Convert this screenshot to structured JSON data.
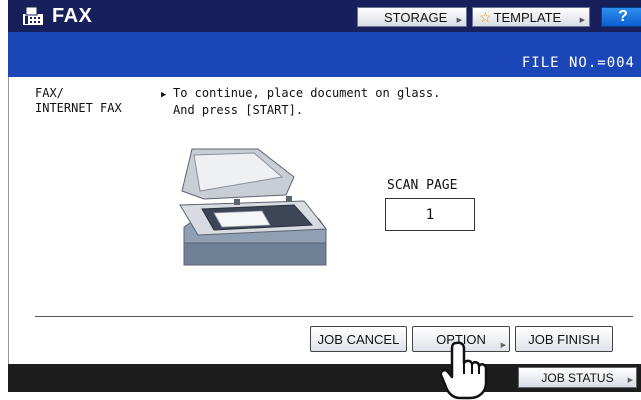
{
  "app": {
    "title": "FAX"
  },
  "toolbar": {
    "storage_label": "STORAGE",
    "template_label": "TEMPLATE",
    "help_label": "?"
  },
  "header": {
    "file_no": "FILE NO.=004"
  },
  "mode": {
    "line1": "FAX/",
    "line2": "INTERNET FAX"
  },
  "message": {
    "line1": "To continue, place document on glass.",
    "line2": "And press [START]."
  },
  "scan": {
    "label": "SCAN PAGE",
    "value": "1"
  },
  "actions": {
    "job_cancel": "JOB CANCEL",
    "option": "OPTION",
    "job_finish": "JOB FINISH"
  },
  "footer": {
    "job_status": "JOB STATUS"
  },
  "colors": {
    "title_bar": "#17205a",
    "header_band": "#1b46b8",
    "footer_bar": "#1d1d1d",
    "help_button": "#0c5fd0"
  },
  "icons": {
    "app": "fax-icon",
    "template": "star-icon",
    "submenu": "submenu-arrow-icon",
    "pointer": "hand-pointer-icon",
    "illustration": "scanner-illustration"
  }
}
